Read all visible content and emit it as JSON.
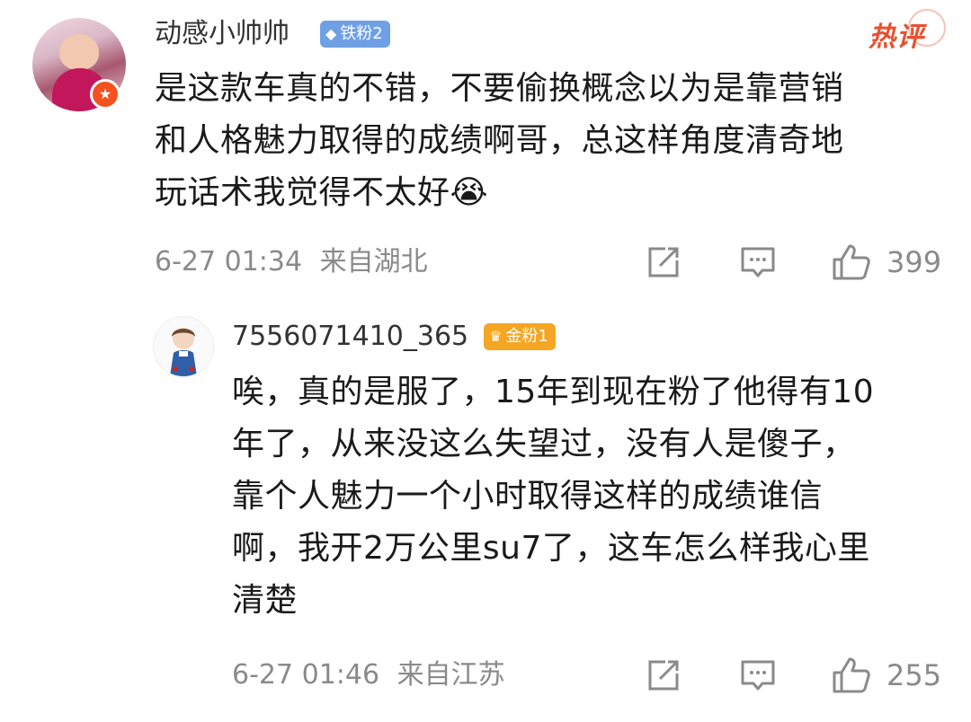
{
  "comment": {
    "username": "动感小帅帅",
    "fan_badge": "铁粉2",
    "hot_label": "热评",
    "text_lines": [
      "是这款车真的不错，不要偷换概念以为是靠营销",
      "和人格魅力取得的成绩啊哥，总这样角度清奇地",
      "玩话术我觉得不太好😭"
    ],
    "timestamp": "6-27 01:34",
    "location": "来自湖北",
    "like_count": "399",
    "icons": {
      "avatar": "user-avatar",
      "vip": "vip-star-icon",
      "share": "share-icon",
      "comment": "comment-icon",
      "like": "thumbs-up-icon"
    }
  },
  "reply": {
    "username": "7556071410_365",
    "fan_badge": "金粉1",
    "text_lines": [
      "唉，真的是服了，15年到现在粉了他得有10",
      "年了，从来没这么失望过，没有人是傻子，",
      "靠个人魅力一个小时取得这样的成绩谁信",
      "啊，我开2万公里su7了，这车怎么样我心里",
      "清楚"
    ],
    "timestamp": "6-27 01:46",
    "location": "来自江苏",
    "like_count": "255"
  },
  "colors": {
    "text": "#1a1a1a",
    "meta": "#8a8a8a",
    "hot": "#e8502f",
    "iron_badge": "#6fa0e6",
    "gold_badge": "#f5a623"
  }
}
